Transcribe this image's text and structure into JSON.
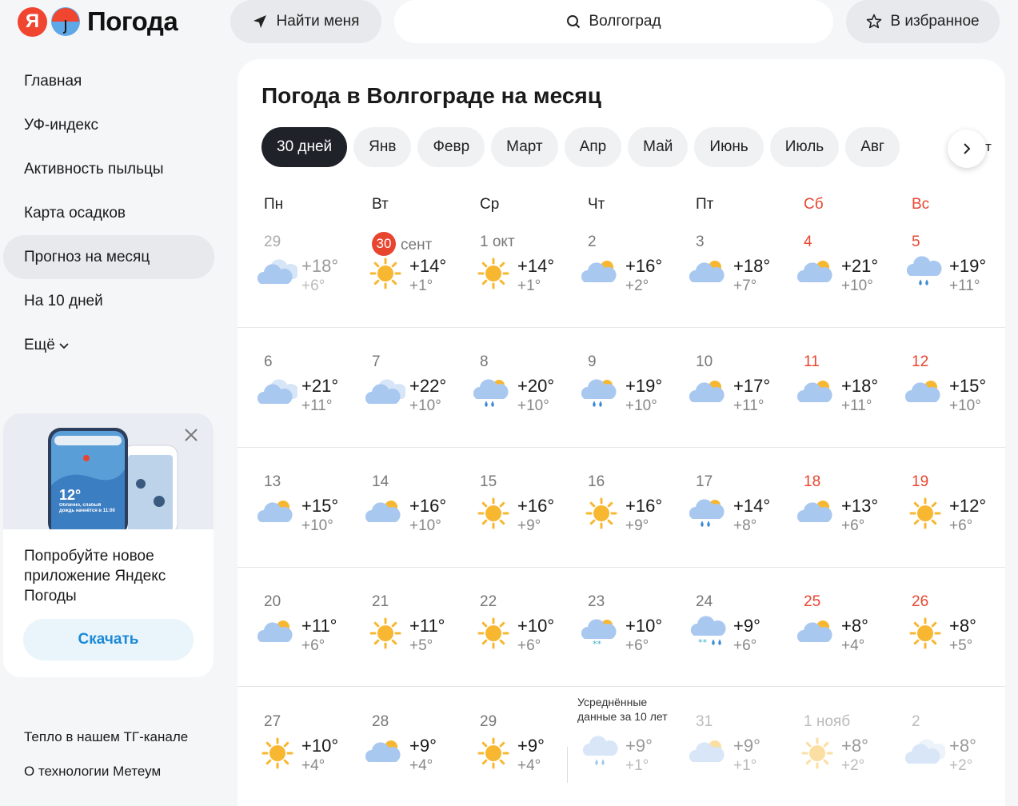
{
  "header": {
    "logo_letter": "Я",
    "logo_text": "Погода",
    "find_me": "Найти меня",
    "search_value": "Волгоград",
    "favorites": "В избранное"
  },
  "nav": {
    "items": [
      "Главная",
      "УФ-индекс",
      "Активность пыльцы",
      "Карта осадков",
      "Прогноз на месяц",
      "На 10 дней",
      "Ещё"
    ],
    "active_index": 4
  },
  "promo": {
    "text": "Попробуйте новое приложение Яндекс Погоды",
    "button": "Скачать",
    "phone_temp": "12°",
    "phone_text": "Облачно, слабый дождь начнётся в 11:00"
  },
  "footer": {
    "tg": "Тепло в нашем ТГ-канале",
    "tech": "О технологии Метеум"
  },
  "main": {
    "title": "Погода в Волгограде на месяц",
    "tabs": [
      "30 дней",
      "Янв",
      "Февр",
      "Март",
      "Апр",
      "Май",
      "Июнь",
      "Июль",
      "Авг"
    ],
    "tab_overflow": "т",
    "weekdays": [
      "Пн",
      "Вт",
      "Ср",
      "Чт",
      "Пт",
      "Сб",
      "Вс"
    ],
    "avg_note": "Усреднённые данные за 10 лет",
    "weeks": [
      [
        {
          "date": "29",
          "hi": "+18°",
          "lo": "+6°",
          "icon": "cloudy-icon",
          "state": "past"
        },
        {
          "date": "сент",
          "today": "30",
          "hi": "+14°",
          "lo": "+1°",
          "icon": "sun-icon"
        },
        {
          "date": "1 окт",
          "hi": "+14°",
          "lo": "+1°",
          "icon": "sun-icon"
        },
        {
          "date": "2",
          "hi": "+16°",
          "lo": "+2°",
          "icon": "partly-cloudy-icon"
        },
        {
          "date": "3",
          "hi": "+18°",
          "lo": "+7°",
          "icon": "partly-cloudy-icon"
        },
        {
          "date": "4",
          "hi": "+21°",
          "lo": "+10°",
          "icon": "partly-cloudy-icon"
        },
        {
          "date": "5",
          "hi": "+19°",
          "lo": "+11°",
          "icon": "rain-icon"
        }
      ],
      [
        {
          "date": "6",
          "hi": "+21°",
          "lo": "+11°",
          "icon": "cloudy-icon"
        },
        {
          "date": "7",
          "hi": "+22°",
          "lo": "+10°",
          "icon": "cloudy-icon"
        },
        {
          "date": "8",
          "hi": "+20°",
          "lo": "+10°",
          "icon": "sun-rain-icon"
        },
        {
          "date": "9",
          "hi": "+19°",
          "lo": "+10°",
          "icon": "sun-rain-icon"
        },
        {
          "date": "10",
          "hi": "+17°",
          "lo": "+11°",
          "icon": "partly-cloudy-icon"
        },
        {
          "date": "11",
          "hi": "+18°",
          "lo": "+11°",
          "icon": "partly-cloudy-icon"
        },
        {
          "date": "12",
          "hi": "+15°",
          "lo": "+10°",
          "icon": "partly-cloudy-icon"
        }
      ],
      [
        {
          "date": "13",
          "hi": "+15°",
          "lo": "+10°",
          "icon": "partly-cloudy-icon"
        },
        {
          "date": "14",
          "hi": "+16°",
          "lo": "+10°",
          "icon": "partly-cloudy-icon"
        },
        {
          "date": "15",
          "hi": "+16°",
          "lo": "+9°",
          "icon": "sun-icon"
        },
        {
          "date": "16",
          "hi": "+16°",
          "lo": "+9°",
          "icon": "sun-icon"
        },
        {
          "date": "17",
          "hi": "+14°",
          "lo": "+8°",
          "icon": "sun-rain-icon"
        },
        {
          "date": "18",
          "hi": "+13°",
          "lo": "+6°",
          "icon": "partly-cloudy-icon"
        },
        {
          "date": "19",
          "hi": "+12°",
          "lo": "+6°",
          "icon": "sun-icon"
        }
      ],
      [
        {
          "date": "20",
          "hi": "+11°",
          "lo": "+6°",
          "icon": "partly-cloudy-icon"
        },
        {
          "date": "21",
          "hi": "+11°",
          "lo": "+5°",
          "icon": "sun-icon"
        },
        {
          "date": "22",
          "hi": "+10°",
          "lo": "+6°",
          "icon": "sun-icon"
        },
        {
          "date": "23",
          "hi": "+10°",
          "lo": "+6°",
          "icon": "sun-snow-icon"
        },
        {
          "date": "24",
          "hi": "+9°",
          "lo": "+6°",
          "icon": "sleet-icon"
        },
        {
          "date": "25",
          "hi": "+8°",
          "lo": "+4°",
          "icon": "partly-cloudy-icon"
        },
        {
          "date": "26",
          "hi": "+8°",
          "lo": "+5°",
          "icon": "sun-icon"
        }
      ],
      [
        {
          "date": "27",
          "hi": "+10°",
          "lo": "+4°",
          "icon": "sun-icon"
        },
        {
          "date": "28",
          "hi": "+9°",
          "lo": "+4°",
          "icon": "partly-cloudy-icon"
        },
        {
          "date": "29",
          "hi": "+9°",
          "lo": "+4°",
          "icon": "sun-icon"
        },
        {
          "date": "",
          "hi": "+9°",
          "lo": "+1°",
          "icon": "rain-icon",
          "state": "dim"
        },
        {
          "date": "31",
          "hi": "+9°",
          "lo": "+1°",
          "icon": "partly-cloudy-icon",
          "state": "dim"
        },
        {
          "date": "1 нояб",
          "hi": "+8°",
          "lo": "+2°",
          "icon": "sun-icon",
          "state": "dim"
        },
        {
          "date": "2",
          "hi": "+8°",
          "lo": "+2°",
          "icon": "cloudy-icon",
          "state": "dim"
        }
      ]
    ]
  },
  "colors": {
    "accent_red": "#e8452f",
    "tab_active": "#1f2229",
    "sun": "#f7b731",
    "cloud": "#a9c8f0",
    "link_blue": "#1a8ad6"
  }
}
